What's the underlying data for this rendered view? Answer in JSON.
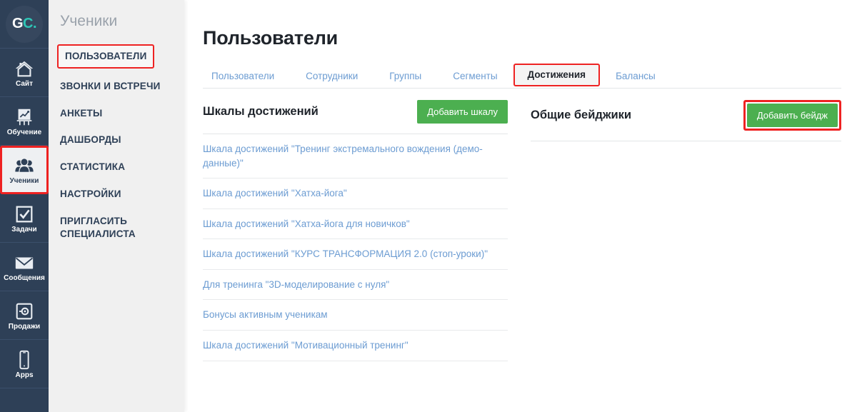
{
  "brand": {
    "logo_first": "G",
    "logo_second": "C."
  },
  "colors": {
    "rail_bg": "#2e4057",
    "accent_teal": "#2ec5b6",
    "highlight_red": "#ee2222",
    "button_green": "#4caf50",
    "link_blue": "#6c9cd2"
  },
  "rail": {
    "items": [
      {
        "label": "Сайт",
        "icon": "home-icon",
        "active": false
      },
      {
        "label": "Обучение",
        "icon": "chart-easel-icon",
        "active": false
      },
      {
        "label": "Ученики",
        "icon": "users-group-icon",
        "active": true
      },
      {
        "label": "Задачи",
        "icon": "checkbox-icon",
        "active": false
      },
      {
        "label": "Сообщения",
        "icon": "envelope-icon",
        "active": false
      },
      {
        "label": "Продажи",
        "icon": "safe-box-icon",
        "active": false
      },
      {
        "label": "Apps",
        "icon": "mobile-phone-icon",
        "active": false
      }
    ]
  },
  "submenu": {
    "title": "Ученики",
    "items": [
      {
        "label": "ПОЛЬЗОВАТЕЛИ",
        "highlighted": true
      },
      {
        "label": "ЗВОНКИ И ВСТРЕЧИ",
        "highlighted": false
      },
      {
        "label": "АНКЕТЫ",
        "highlighted": false
      },
      {
        "label": "ДАШБОРДЫ",
        "highlighted": false
      },
      {
        "label": "СТАТИСТИКА",
        "highlighted": false
      },
      {
        "label": "НАСТРОЙКИ",
        "highlighted": false
      },
      {
        "label": "ПРИГЛАСИТЬ СПЕЦИАЛИСТА",
        "highlighted": false
      }
    ]
  },
  "main": {
    "page_title": "Пользователи",
    "tabs": [
      {
        "label": "Пользователи",
        "active": false
      },
      {
        "label": "Сотрудники",
        "active": false
      },
      {
        "label": "Группы",
        "active": false
      },
      {
        "label": "Сегменты",
        "active": false
      },
      {
        "label": "Достижения",
        "active": true
      },
      {
        "label": "Балансы",
        "active": false
      }
    ],
    "left_column": {
      "heading": "Шкалы достижений",
      "add_button": "Добавить шкалу",
      "add_button_highlighted": false,
      "items": [
        "Шкала достижений \"Тренинг экстремального вождения (демо-данные)\"",
        "Шкала достижений \"Хатха-йога\"",
        "Шкала достижений \"Хатха-йога для новичков\"",
        "Шкала достижений \"КУРС ТРАНСФОРМАЦИЯ 2.0 (стоп-уроки)\"",
        "Для тренинга \"3D-моделирование с нуля\"",
        "Бонусы активным ученикам",
        "Шкала достижений \"Мотивационный тренинг\""
      ]
    },
    "right_column": {
      "heading": "Общие бейджики",
      "add_button": "Добавить бейдж",
      "add_button_highlighted": true,
      "items": []
    }
  }
}
